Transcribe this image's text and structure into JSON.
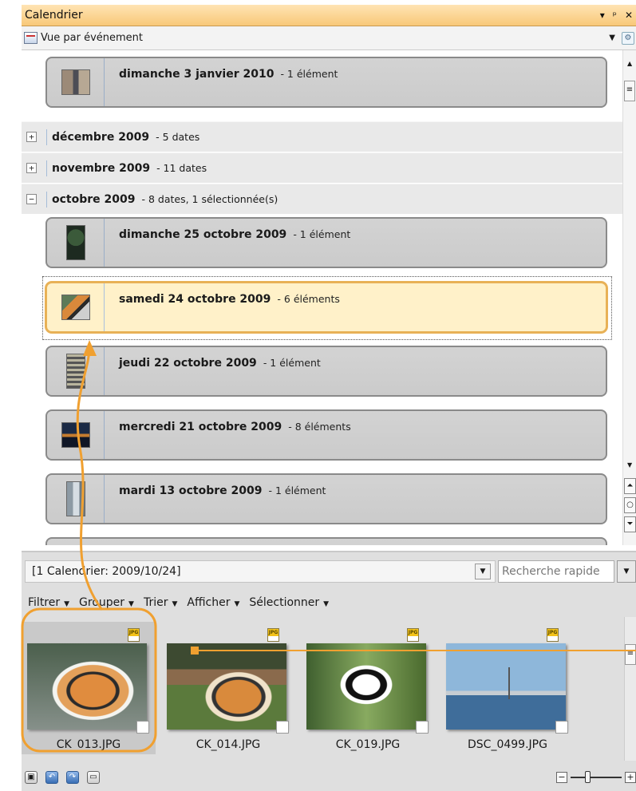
{
  "titlebar": {
    "title": "Calendrier",
    "pin": "▾",
    "dock": "ᵖ",
    "close": "✕"
  },
  "viewbar": {
    "label": "Vue par événement"
  },
  "list": {
    "top_card": {
      "date": "dimanche 3 janvier 2010",
      "count": "- 1 élément"
    },
    "groups": [
      {
        "label": "décembre 2009",
        "meta": "- 5 dates",
        "state": "+"
      },
      {
        "label": "novembre 2009",
        "meta": "- 11 dates",
        "state": "+"
      },
      {
        "label": "octobre 2009",
        "meta": "- 8 dates, 1 sélectionnée(s)",
        "state": "−"
      }
    ],
    "cards": [
      {
        "date": "dimanche 25 octobre 2009",
        "count": "- 1 élément"
      },
      {
        "date": "samedi 24 octobre 2009",
        "count": "- 6 éléments"
      },
      {
        "date": "jeudi 22 octobre 2009",
        "count": "- 1 élément"
      },
      {
        "date": "mercredi 21 octobre 2009",
        "count": "- 8 éléments"
      },
      {
        "date": "mardi 13 octobre 2009",
        "count": "- 1 élément"
      }
    ]
  },
  "lower": {
    "path": "[1 Calendrier: 2009/10/24]",
    "search_placeholder": "Recherche rapide",
    "menu": [
      "Filtrer",
      "Grouper",
      "Trier",
      "Afficher",
      "Sélectionner"
    ],
    "files": [
      "CK_013.JPG",
      "CK_014.JPG",
      "CK_019.JPG",
      "DSC_0499.JPG"
    ],
    "badge": "JPG"
  },
  "colors": {
    "accent": "#f0a030",
    "selected_bg": "#fff1c9"
  }
}
